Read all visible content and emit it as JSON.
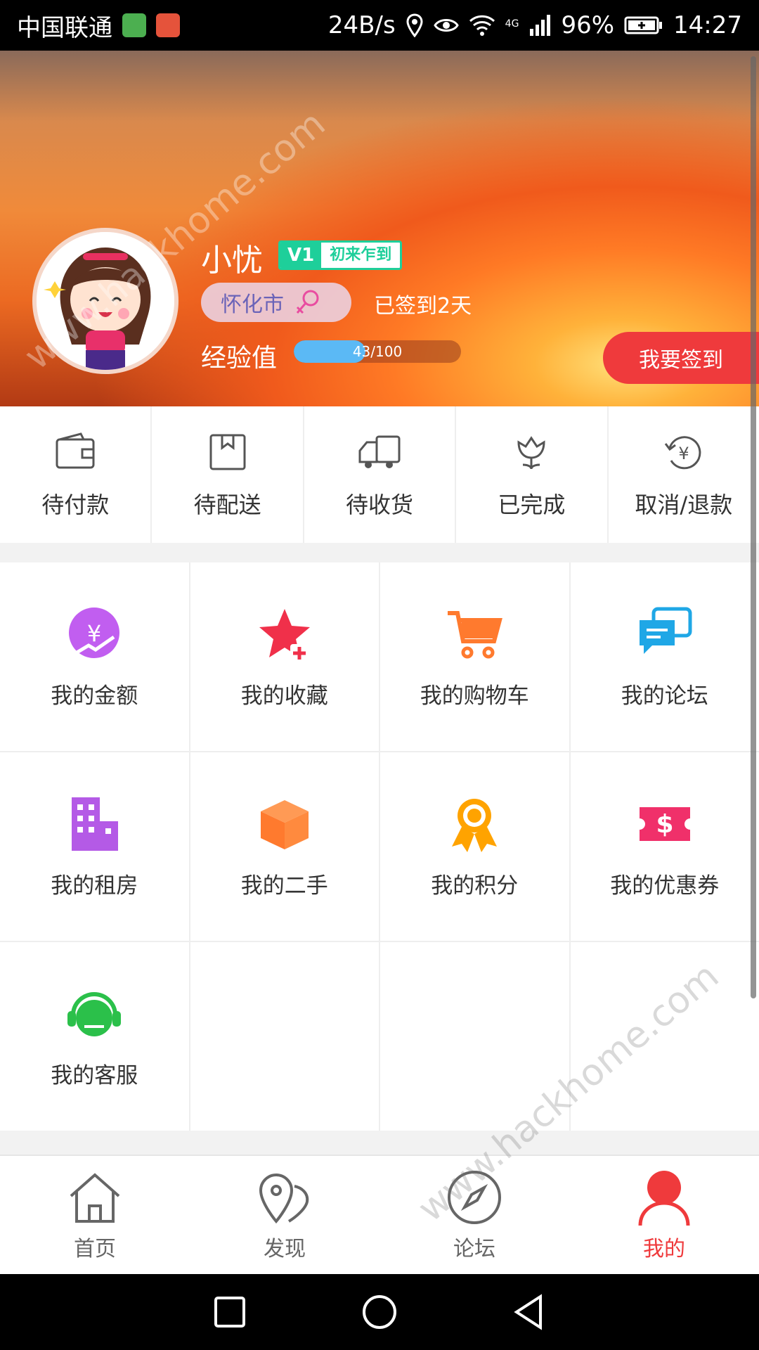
{
  "status_bar": {
    "carrier": "中国联通",
    "network_speed": "24B/s",
    "signal_tag": "4G",
    "battery": "96%",
    "time": "14:27"
  },
  "profile": {
    "username": "小忧",
    "level": "V1",
    "level_title": "初来乍到",
    "city": "怀化市",
    "signed_days": "已签到2天",
    "exp_label": "经验值",
    "exp_text": "43/100",
    "exp_current": 43,
    "exp_max": 100,
    "checkin_button": "我要签到"
  },
  "orders": [
    {
      "label": "待付款",
      "icon": "wallet-icon"
    },
    {
      "label": "待配送",
      "icon": "package-icon"
    },
    {
      "label": "待收货",
      "icon": "truck-icon"
    },
    {
      "label": "已完成",
      "icon": "flower-icon"
    },
    {
      "label": "取消/退款",
      "icon": "refund-icon"
    }
  ],
  "grid": [
    {
      "label": "我的金额",
      "icon": "money-icon",
      "color": "#c15ef0"
    },
    {
      "label": "我的收藏",
      "icon": "star-add-icon",
      "color": "#f0304a"
    },
    {
      "label": "我的购物车",
      "icon": "cart-icon",
      "color": "#ff7a2e"
    },
    {
      "label": "我的论坛",
      "icon": "chat-icon",
      "color": "#1fa7e6"
    },
    {
      "label": "我的租房",
      "icon": "building-icon",
      "color": "#b45ae6"
    },
    {
      "label": "我的二手",
      "icon": "box-icon",
      "color": "#ff7a2e"
    },
    {
      "label": "我的积分",
      "icon": "medal-icon",
      "color": "#ffa300"
    },
    {
      "label": "我的优惠券",
      "icon": "coupon-icon",
      "color": "#f0306a"
    },
    {
      "label": "我的客服",
      "icon": "headset-icon",
      "color": "#2bc04a"
    }
  ],
  "tabs": [
    {
      "label": "首页",
      "icon": "home-icon"
    },
    {
      "label": "发现",
      "icon": "map-pin-icon"
    },
    {
      "label": "论坛",
      "icon": "compass-icon"
    },
    {
      "label": "我的",
      "icon": "user-icon"
    }
  ],
  "watermark": "www.hackhome.com",
  "colors": {
    "accent": "#ef3a3c",
    "badge": "#1ecf9a",
    "exp_bar": "#5bb9f5"
  }
}
